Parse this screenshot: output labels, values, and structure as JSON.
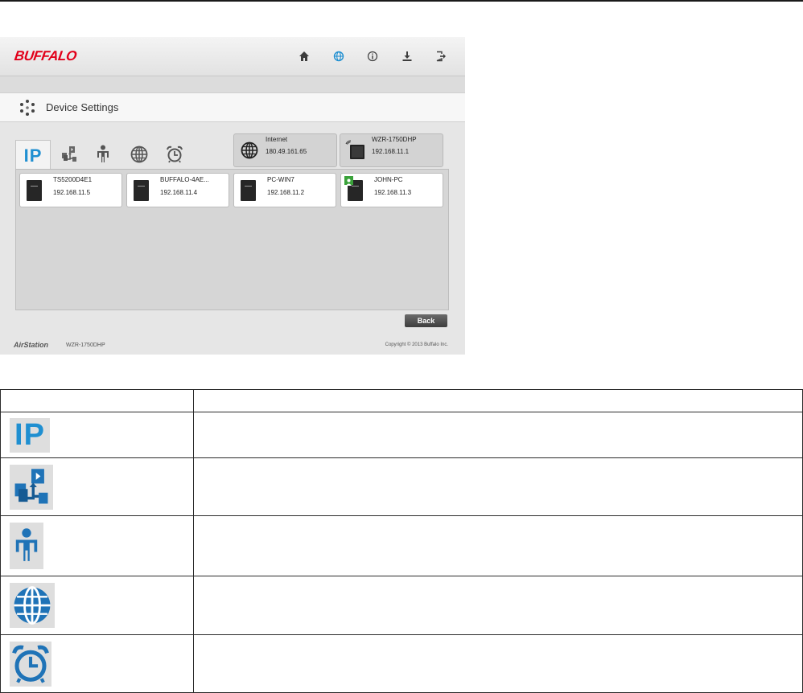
{
  "header": {
    "logo": "BUFFALO",
    "icons": [
      "home-icon",
      "globe-icon",
      "info-icon",
      "download-icon",
      "logout-icon"
    ]
  },
  "page": {
    "title": "Device Settings"
  },
  "tabs": [
    {
      "label": "IP",
      "icon": "ip-icon"
    },
    {
      "icon": "network-devices-icon"
    },
    {
      "icon": "person-icon"
    },
    {
      "icon": "globe-icon"
    },
    {
      "icon": "alarm-clock-icon"
    }
  ],
  "internet": {
    "name": "Internet",
    "ip": "180.49.161.65"
  },
  "router": {
    "name": "WZR-1750DHP",
    "ip": "192.168.11.1"
  },
  "devices": [
    {
      "name": "TS5200D4E1",
      "ip": "192.168.11.5"
    },
    {
      "name": "BUFFALO-4AE...",
      "ip": "192.168.11.4"
    },
    {
      "name": "PC-WIN7",
      "ip": "192.168.11.2"
    },
    {
      "name": "JOHN-PC",
      "ip": "192.168.11.3"
    }
  ],
  "back_label": "Back",
  "footer": {
    "brand": "AirStation",
    "model": "WZR-1750DHP",
    "copyright": "Copyright © 2013 Buffalo Inc."
  },
  "legend": {
    "header": [
      "",
      ""
    ],
    "rows": [
      {
        "icon": "ip-icon",
        "label": "IP",
        "description": ""
      },
      {
        "icon": "network-devices-icon",
        "description": ""
      },
      {
        "icon": "person-icon",
        "description": ""
      },
      {
        "icon": "globe-icon",
        "description": ""
      },
      {
        "icon": "alarm-clock-icon",
        "description": ""
      }
    ]
  },
  "colors": {
    "accent": "#1f8fd1",
    "brand": "#e2001a",
    "badge": "#3aa23a"
  }
}
